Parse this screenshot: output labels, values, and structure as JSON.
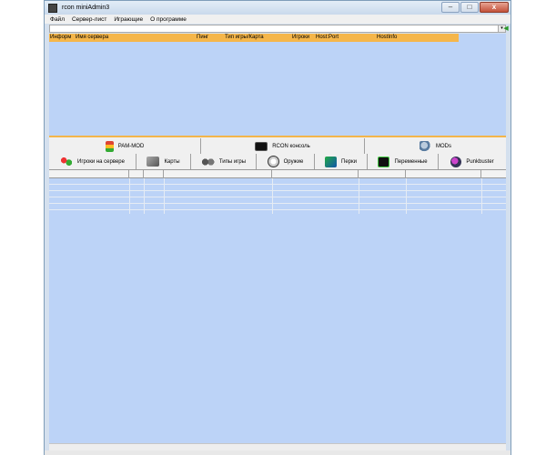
{
  "window": {
    "title": "rcon miniAdmin3",
    "controls": {
      "minimize": "–",
      "maximize": "□",
      "close": "x"
    }
  },
  "menu": {
    "items": [
      "Файл",
      "Сервер-лист",
      "Играющие",
      "О программе"
    ]
  },
  "address": {
    "dropdown_glyph": "▾",
    "go_glyph": "◀"
  },
  "server_list": {
    "columns": [
      "Информ",
      "Имя сервера",
      "Пинг",
      "Тип игры/Карта",
      "Игроки",
      "Host:Port",
      "HostInfo"
    ]
  },
  "tabs": {
    "row1": [
      {
        "label": "PAM-MOD",
        "icon": "traffic-light-icon"
      },
      {
        "label": "RCON консоль",
        "icon": "console-icon"
      },
      {
        "label": "MODs",
        "icon": "gears-icon"
      }
    ],
    "row2": [
      {
        "label": "Игроки на сервере",
        "icon": "players-icon"
      },
      {
        "label": "Карты",
        "icon": "map-icon"
      },
      {
        "label": "Типы игры",
        "icon": "game-types-icon"
      },
      {
        "label": "Оружие",
        "icon": "weapon-icon"
      },
      {
        "label": "Перки",
        "icon": "perks-icon"
      },
      {
        "label": "Переменные",
        "icon": "variables-icon"
      },
      {
        "label": "Punkbuster",
        "icon": "punkbuster-icon"
      }
    ]
  },
  "colors": {
    "list_background": "#bcd3f7",
    "header_orange": "#f5b64a"
  }
}
